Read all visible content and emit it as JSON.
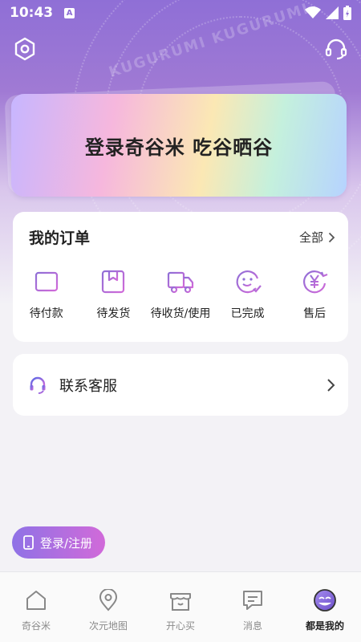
{
  "status_bar": {
    "time": "10:43",
    "notification_badge": "A"
  },
  "hero": {
    "watermark": "KUGURUMI KUGURUMI"
  },
  "banner": {
    "title": "登录奇谷米 吃谷晒谷"
  },
  "orders": {
    "title": "我的订单",
    "all_label": "全部",
    "items": [
      {
        "label": "待付款",
        "icon": "wallet-icon"
      },
      {
        "label": "待发货",
        "icon": "package-icon"
      },
      {
        "label": "待收货/使用",
        "icon": "truck-icon"
      },
      {
        "label": "已完成",
        "icon": "smile-check-icon"
      },
      {
        "label": "售后",
        "icon": "yen-refund-icon"
      }
    ]
  },
  "service": {
    "label": "联系客服"
  },
  "login_button": {
    "label": "登录/注册"
  },
  "tabbar": {
    "items": [
      {
        "label": "奇谷米",
        "icon": "home-icon"
      },
      {
        "label": "次元地图",
        "icon": "map-pin-icon"
      },
      {
        "label": "开心买",
        "icon": "shop-icon"
      },
      {
        "label": "消息",
        "icon": "message-icon"
      },
      {
        "label": "都是我的",
        "icon": "avatar-icon"
      }
    ]
  },
  "colors": {
    "accent": "#8f6fd6",
    "accent_pink": "#d16ad9"
  }
}
